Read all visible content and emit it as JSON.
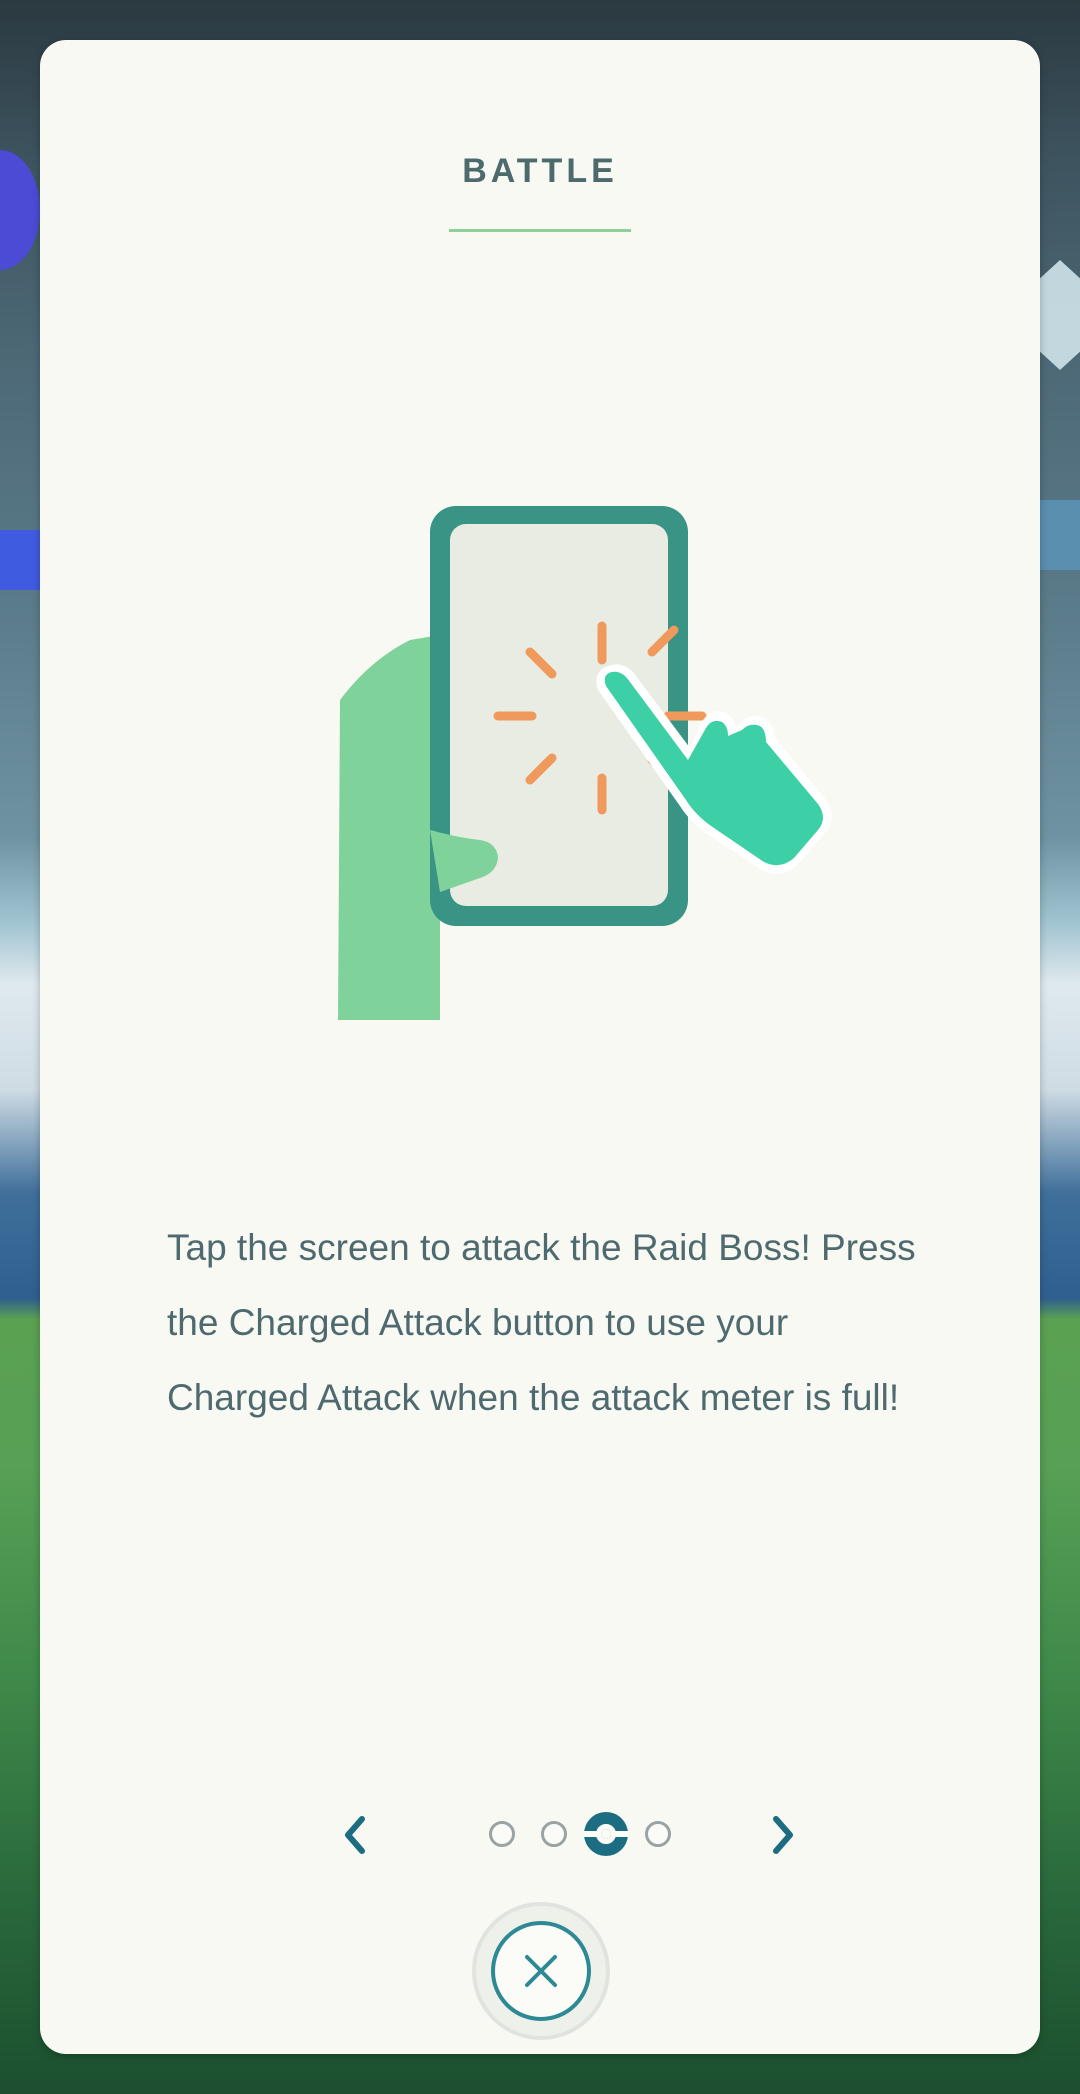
{
  "dialog": {
    "title": "BATTLE",
    "description": "Tap the screen to attack the Raid Boss! Press the Charged Attack button to use your Charged Attack when the attack meter is full!",
    "illustration_icon": "tap-phone-icon",
    "colors": {
      "accent_teal": "#1d6d82",
      "phone_frame": "#3a9486",
      "hand_light": "#7fd39a",
      "hand_teal": "#3dcfa6",
      "tap_rays": "#ef9a5c"
    }
  },
  "pagination": {
    "page_count": 4,
    "current_page": 3,
    "prev_icon": "chevron-left-icon",
    "next_icon": "chevron-right-icon"
  },
  "close_button": {
    "icon": "close-icon"
  }
}
